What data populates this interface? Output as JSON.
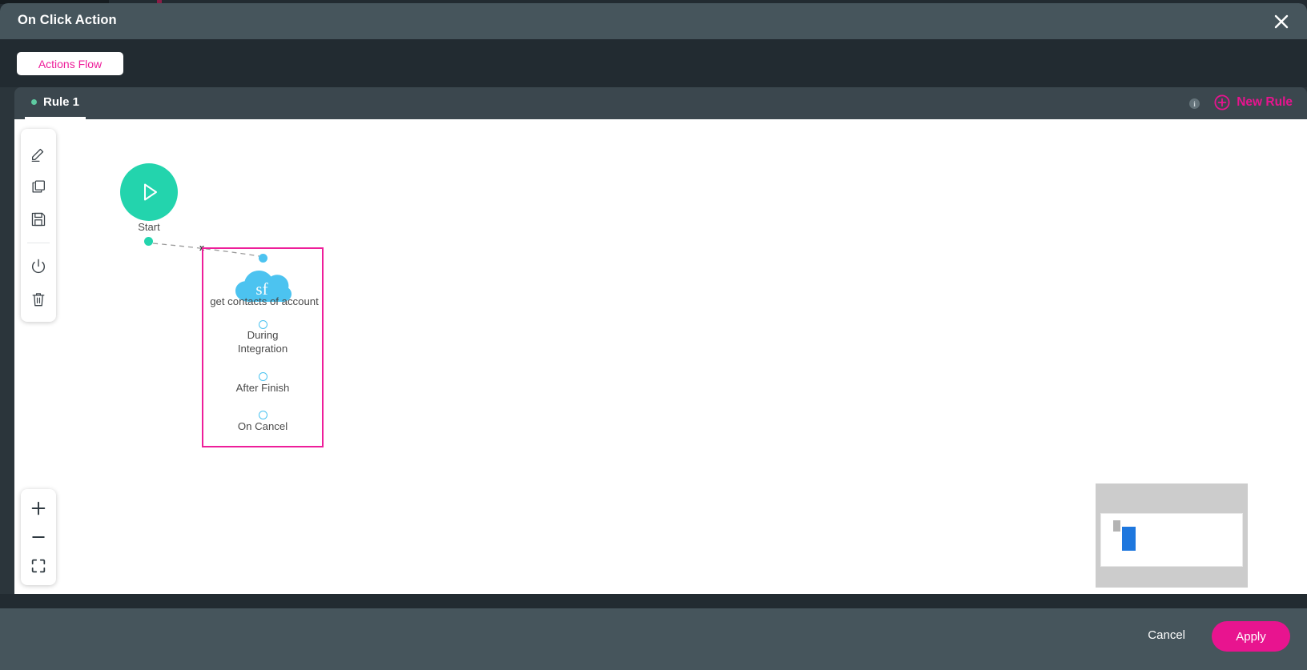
{
  "window": {
    "title": "On Click Action",
    "close_icon": "close-icon"
  },
  "subheader": {
    "chip_label": "Actions Flow"
  },
  "rulebar": {
    "tab_label": "Rule 1",
    "info_icon_char": "i",
    "new_rule_label": "New Rule",
    "accent_color": "#e8148f",
    "dot_color": "#5ecba1"
  },
  "toolbar": {
    "items": [
      {
        "name": "edit-icon",
        "title": "Edit"
      },
      {
        "name": "copy-icon",
        "title": "Copy"
      },
      {
        "name": "save-icon",
        "title": "Save"
      },
      {
        "name": "power-icon",
        "title": "Enable / Disable"
      },
      {
        "name": "trash-icon",
        "title": "Delete"
      }
    ]
  },
  "zoom_controls": {
    "items": [
      {
        "name": "zoom-in-icon",
        "title": "Zoom in"
      },
      {
        "name": "zoom-out-icon",
        "title": "Zoom out"
      },
      {
        "name": "fit-to-screen-icon",
        "title": "Fit to screen"
      }
    ]
  },
  "flow": {
    "start_node": {
      "label": "Start",
      "icon": "play-icon",
      "color": "#23d4ad"
    },
    "salesforce_node": {
      "badge_text": "sf",
      "badge_color": "#4cc3f0",
      "title": "get contacts of account",
      "selected_border_color": "#ee1e9a",
      "ports": [
        {
          "label": "During\nIntegration"
        },
        {
          "label": "After Finish"
        },
        {
          "label": "On Cancel"
        }
      ],
      "port_labels": [
        "During Integration",
        "After Finish",
        "On Cancel"
      ]
    },
    "edge_marker": "x"
  },
  "minimap": {
    "name": "minimap",
    "nodes": [
      {
        "name": "start",
        "color": "#b3b3b3"
      },
      {
        "name": "salesforce",
        "color": "#1e77de"
      }
    ]
  },
  "footer": {
    "cancel_label": "Cancel",
    "apply_label": "Apply",
    "apply_color": "#e8148f"
  }
}
